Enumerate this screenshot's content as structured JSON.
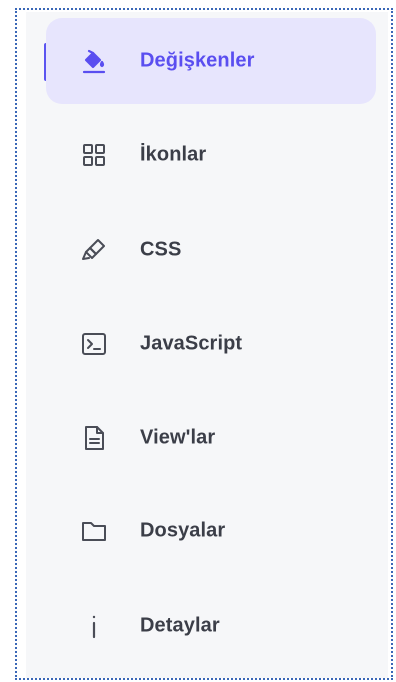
{
  "sidebar": {
    "items": [
      {
        "label": "Değişkenler",
        "icon": "paint-bucket-icon",
        "active": true
      },
      {
        "label": "İkonlar",
        "icon": "grid-icon",
        "active": false
      },
      {
        "label": "CSS",
        "icon": "highlighter-icon",
        "active": false
      },
      {
        "label": "JavaScript",
        "icon": "terminal-icon",
        "active": false
      },
      {
        "label": "View'lar",
        "icon": "document-icon",
        "active": false
      },
      {
        "label": "Dosyalar",
        "icon": "folder-icon",
        "active": false
      },
      {
        "label": "Detaylar",
        "icon": "info-icon",
        "active": false
      }
    ]
  },
  "colors": {
    "accent": "#5b54f0",
    "active_background": "#e7e5fd",
    "text": "#3b3e48",
    "icon": "#4a4d57",
    "sidebar_background": "#f6f7f9"
  }
}
